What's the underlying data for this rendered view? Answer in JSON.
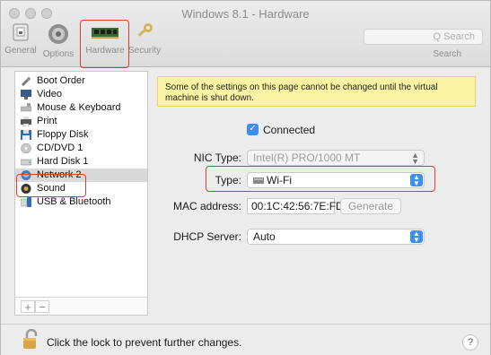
{
  "window": {
    "title": "Windows 8.1 - Hardware"
  },
  "toolbar": {
    "items": [
      {
        "label": "General"
      },
      {
        "label": "Options"
      },
      {
        "label": "Hardware"
      },
      {
        "label": "Security"
      }
    ],
    "search_placeholder": "Q Search",
    "search_label": "Search"
  },
  "sidebar": {
    "items": [
      {
        "label": "Boot Order",
        "icon": "boot-order-icon"
      },
      {
        "label": "Video",
        "icon": "video-icon"
      },
      {
        "label": "Mouse & Keyboard",
        "icon": "keyboard-icon"
      },
      {
        "label": "Print",
        "icon": "printer-icon"
      },
      {
        "label": "Floppy Disk",
        "icon": "floppy-icon"
      },
      {
        "label": "CD/DVD 1",
        "icon": "cd-icon"
      },
      {
        "label": "Hard Disk 1",
        "icon": "hard-disk-icon"
      },
      {
        "label": "Network 2",
        "icon": "network-icon",
        "selected": true
      },
      {
        "label": "Sound",
        "icon": "sound-icon"
      },
      {
        "label": "USB & Bluetooth",
        "icon": "usb-icon"
      }
    ],
    "add_label": "+",
    "remove_label": "−"
  },
  "main": {
    "warning": "Some of the settings on this page cannot be changed until the virtual machine is shut down.",
    "connected": {
      "label": "Connected",
      "checked": true
    },
    "nic_type": {
      "label": "NIC Type:",
      "value": "Intel(R) PRO/1000 MT"
    },
    "type": {
      "label": "Type:",
      "value": "Wi-Fi"
    },
    "mac": {
      "label": "MAC address:",
      "value": "00:1C:42:56:7E:FD",
      "generate_label": "Generate"
    },
    "dhcp": {
      "label": "DHCP Server:",
      "value": "Auto"
    }
  },
  "footer": {
    "lock_text": "Click the lock to prevent further changes.",
    "help_label": "?"
  },
  "colors": {
    "accent": "#3d8ef2",
    "highlight": "#e03c31",
    "warning_bg": "#fbf3a4"
  }
}
